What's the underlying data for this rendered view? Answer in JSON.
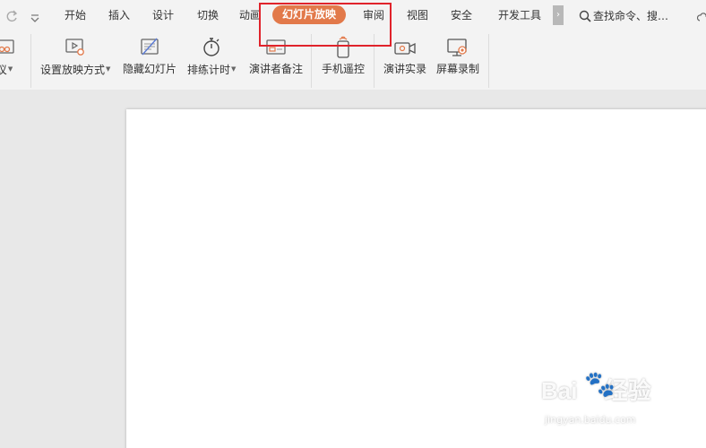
{
  "toolbar": {
    "redo_icon": "redo-icon",
    "dropdown_icon": "chevron-down-icon"
  },
  "menu": {
    "tabs": [
      {
        "label": "开始"
      },
      {
        "label": "插入"
      },
      {
        "label": "设计"
      },
      {
        "label": "切换"
      },
      {
        "label": "动画"
      },
      {
        "label": "幻灯片放映",
        "active": true
      },
      {
        "label": "审阅"
      },
      {
        "label": "视图"
      },
      {
        "label": "安全"
      },
      {
        "label": "开发工具"
      }
    ],
    "more_label": "›",
    "search_label": "查找命令、搜…",
    "active_color": "#e2794a"
  },
  "ribbon": {
    "items": [
      {
        "label": "议",
        "icon": "meeting-icon",
        "dropdown": true
      },
      {
        "label": "设置放映方式",
        "icon": "slideshow-settings-icon",
        "dropdown": true
      },
      {
        "label": "隐藏幻灯片",
        "icon": "hide-slide-icon"
      },
      {
        "label": "排练计时",
        "icon": "stopwatch-icon",
        "dropdown": true
      },
      {
        "label": "演讲者备注",
        "icon": "speaker-notes-icon"
      },
      {
        "label": "手机遥控",
        "icon": "phone-remote-icon"
      },
      {
        "label": "演讲实录",
        "icon": "video-record-icon"
      },
      {
        "label": "屏幕录制",
        "icon": "screen-record-icon"
      }
    ]
  },
  "annotation": {
    "color": "#e0232b"
  },
  "watermark": {
    "brand": "Bai",
    "brand_end": "经验",
    "url": "jingyan.baidu.com"
  }
}
